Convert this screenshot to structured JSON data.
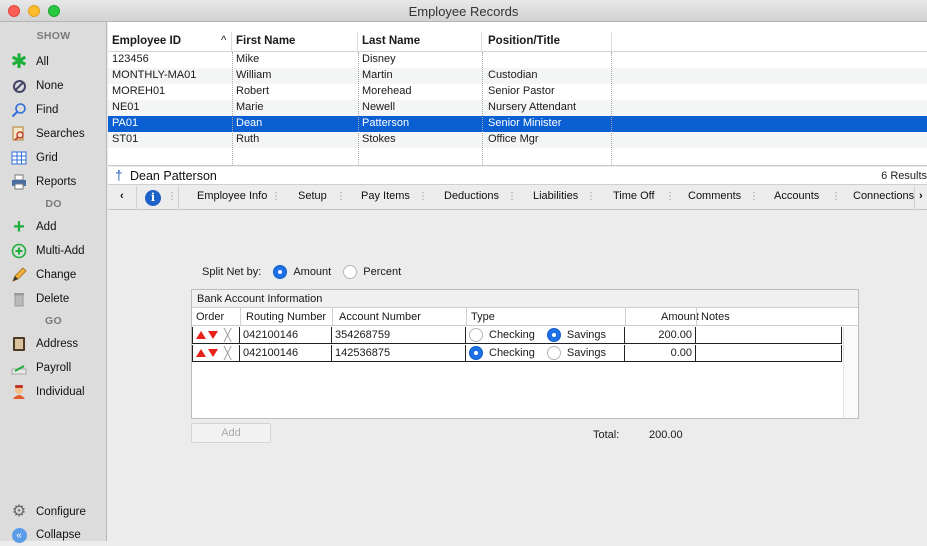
{
  "window": {
    "title": "Employee Records"
  },
  "sidebar": {
    "show_label": "SHOW",
    "do_label": "DO",
    "go_label": "GO",
    "show_items": [
      {
        "label": "All",
        "icon": "asterisk-icon"
      },
      {
        "label": "None",
        "icon": "none-icon"
      },
      {
        "label": "Find",
        "icon": "search-icon"
      },
      {
        "label": "Searches",
        "icon": "searches-icon"
      },
      {
        "label": "Grid",
        "icon": "grid-icon"
      },
      {
        "label": "Reports",
        "icon": "printer-icon"
      }
    ],
    "do_items": [
      {
        "label": "Add",
        "icon": "plus-icon"
      },
      {
        "label": "Multi-Add",
        "icon": "multi-add-icon"
      },
      {
        "label": "Change",
        "icon": "pencil-icon"
      },
      {
        "label": "Delete",
        "icon": "trash-icon"
      }
    ],
    "go_items": [
      {
        "label": "Address",
        "icon": "address-book-icon"
      },
      {
        "label": "Payroll",
        "icon": "payroll-icon"
      },
      {
        "label": "Individual",
        "icon": "individual-icon"
      }
    ],
    "configure_label": "Configure",
    "collapse_label": "Collapse"
  },
  "table": {
    "columns": [
      "Employee ID",
      "First Name",
      "Last Name",
      "Position/Title"
    ],
    "sort_indicator": "^",
    "rows": [
      [
        "123456",
        "Mike",
        "Disney",
        ""
      ],
      [
        "MONTHLY-MA01",
        "William",
        "Martin",
        "Custodian"
      ],
      [
        "MOREH01",
        "Robert",
        "Morehead",
        "Senior Pastor"
      ],
      [
        "NE01",
        "Marie",
        "Newell",
        "Nursery Attendant"
      ],
      [
        "PA01",
        "Dean",
        "Patterson",
        "Senior Minister"
      ],
      [
        "ST01",
        "Ruth",
        "Stokes",
        "Office Mgr"
      ]
    ],
    "selected_row": 4
  },
  "namebar": {
    "name": "Dean Patterson",
    "count": "6 Results"
  },
  "tabs": {
    "back": "‹",
    "more": "›",
    "sep": "⋮",
    "items": [
      "Employee Info",
      "Setup",
      "Pay Items",
      "Deductions",
      "Liabilities",
      "Time Off",
      "Comments",
      "Accounts",
      "Connections"
    ],
    "active": "Accounts"
  },
  "accounts": {
    "split_label": "Split Net by:",
    "split_amount": "Amount",
    "split_percent": "Percent",
    "split_selected": "Amount",
    "bank_title": "Bank Account Information",
    "headers": [
      "Order",
      "Routing Number",
      "Account Number",
      "Type",
      "Amount",
      "Notes"
    ],
    "checking": "Checking",
    "savings": "Savings",
    "rows": [
      {
        "routing": "042100146",
        "account": "354268759",
        "type": "Savings",
        "amount": "200.00",
        "notes": ""
      },
      {
        "routing": "042100146",
        "account": "142536875",
        "type": "Checking",
        "amount": "0.00",
        "notes": ""
      }
    ],
    "add_label": "Add",
    "total_label": "Total:",
    "total_value": "200.00",
    "delete_mark": "╳"
  },
  "colors": {
    "selection": "#0a5fd3",
    "radio_on": "#1d70e6",
    "arrow": "#e8221b"
  }
}
